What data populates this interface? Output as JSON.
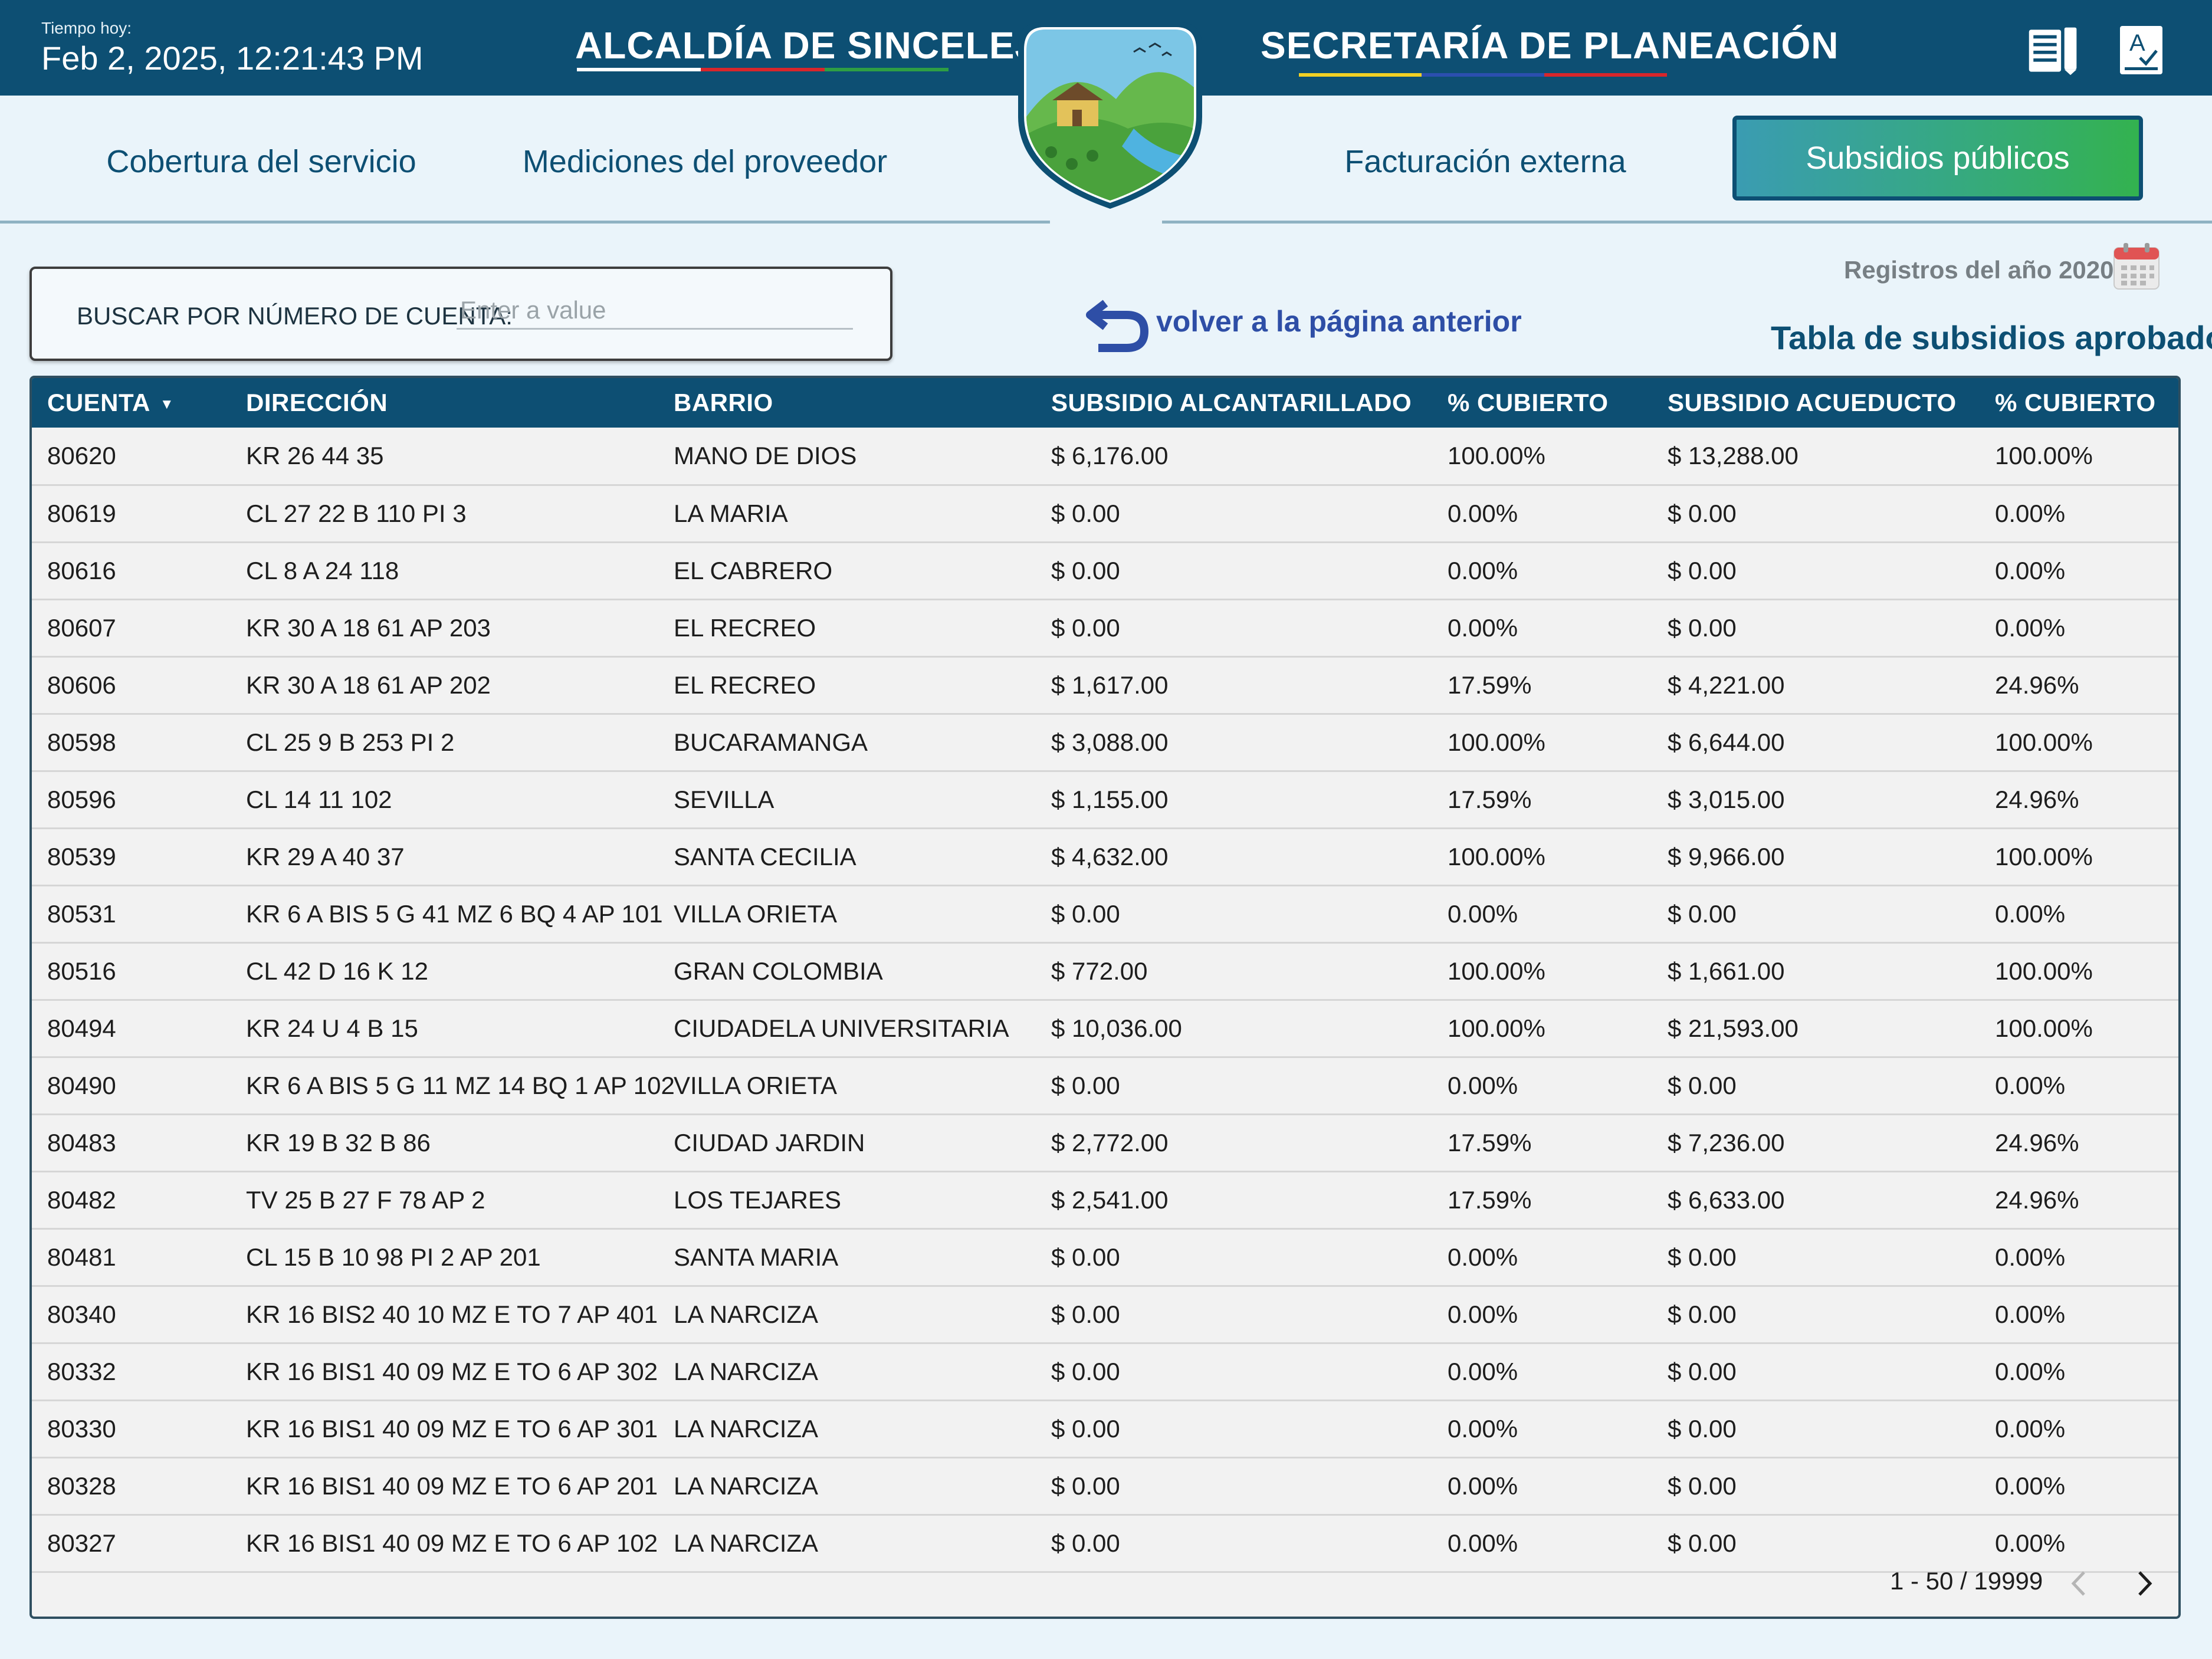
{
  "header": {
    "time_label": "Tiempo hoy:",
    "time_value": "Feb 2, 2025, 12:21:43 PM",
    "title_left": "ALCALDÍA DE SINCELEJO",
    "title_right": "SECRETARÍA DE PLANEACIÓN",
    "icons": [
      "document-icon",
      "spellcheck-icon",
      "shield-logo"
    ]
  },
  "nav": {
    "tabs": [
      {
        "label": "Cobertura del servicio",
        "active": false
      },
      {
        "label": "Mediciones del proveedor",
        "active": false
      },
      {
        "label": "Facturación externa",
        "active": false
      },
      {
        "label": "Subsidios públicos",
        "active": true
      }
    ]
  },
  "search": {
    "label": "BUSCAR POR NÚMERO DE CUENTA:",
    "placeholder": "Enter a value",
    "value": ""
  },
  "back_link": {
    "label": "volver a la página anterior",
    "icon": "undo-arrow-icon"
  },
  "year_label": "Registros del año 2020",
  "table_title": "Tabla de subsidios aprobados",
  "table": {
    "columns": [
      "CUENTA",
      "DIRECCIÓN",
      "BARRIO",
      "SUBSIDIO ALCANTARILLADO",
      "% CUBIERTO",
      "SUBSIDIO ACUEDUCTO",
      "% CUBIERTO"
    ],
    "sort": {
      "column": "CUENTA",
      "direction": "desc"
    },
    "rows": [
      [
        "80620",
        "KR 26 44 35",
        "MANO DE DIOS",
        "$ 6,176.00",
        "100.00%",
        "$ 13,288.00",
        "100.00%"
      ],
      [
        "80619",
        "CL 27 22 B 110 PI 3",
        "LA MARIA",
        "$ 0.00",
        "0.00%",
        "$ 0.00",
        "0.00%"
      ],
      [
        "80616",
        "CL 8 A 24 118",
        "EL CABRERO",
        "$ 0.00",
        "0.00%",
        "$ 0.00",
        "0.00%"
      ],
      [
        "80607",
        "KR 30 A 18 61 AP 203",
        "EL RECREO",
        "$ 0.00",
        "0.00%",
        "$ 0.00",
        "0.00%"
      ],
      [
        "80606",
        "KR 30 A 18 61 AP 202",
        "EL RECREO",
        "$ 1,617.00",
        "17.59%",
        "$ 4,221.00",
        "24.96%"
      ],
      [
        "80598",
        "CL 25 9 B 253 PI 2",
        "BUCARAMANGA",
        "$ 3,088.00",
        "100.00%",
        "$ 6,644.00",
        "100.00%"
      ],
      [
        "80596",
        "CL 14 11 102",
        "SEVILLA",
        "$ 1,155.00",
        "17.59%",
        "$ 3,015.00",
        "24.96%"
      ],
      [
        "80539",
        "KR 29 A 40 37",
        "SANTA CECILIA",
        "$ 4,632.00",
        "100.00%",
        "$ 9,966.00",
        "100.00%"
      ],
      [
        "80531",
        "KR 6 A BIS 5 G 41 MZ 6 BQ 4 AP 101",
        "VILLA ORIETA",
        "$ 0.00",
        "0.00%",
        "$ 0.00",
        "0.00%"
      ],
      [
        "80516",
        "CL 42 D 16 K 12",
        "GRAN COLOMBIA",
        "$ 772.00",
        "100.00%",
        "$ 1,661.00",
        "100.00%"
      ],
      [
        "80494",
        "KR 24 U 4 B 15",
        "CIUDADELA UNIVERSITARIA",
        "$ 10,036.00",
        "100.00%",
        "$ 21,593.00",
        "100.00%"
      ],
      [
        "80490",
        "KR 6 A BIS 5 G 11 MZ 14 BQ 1 AP 102",
        "VILLA ORIETA",
        "$ 0.00",
        "0.00%",
        "$ 0.00",
        "0.00%"
      ],
      [
        "80483",
        "KR 19 B 32 B 86",
        "CIUDAD JARDIN",
        "$ 2,772.00",
        "17.59%",
        "$ 7,236.00",
        "24.96%"
      ],
      [
        "80482",
        "TV 25 B 27 F 78 AP 2",
        "LOS TEJARES",
        "$ 2,541.00",
        "17.59%",
        "$ 6,633.00",
        "24.96%"
      ],
      [
        "80481",
        "CL 15 B 10 98 PI 2 AP 201",
        "SANTA MARIA",
        "$ 0.00",
        "0.00%",
        "$ 0.00",
        "0.00%"
      ],
      [
        "80340",
        "KR 16 BIS2 40 10 MZ E TO 7 AP 401",
        "LA NARCIZA",
        "$ 0.00",
        "0.00%",
        "$ 0.00",
        "0.00%"
      ],
      [
        "80332",
        "KR 16 BIS1 40 09 MZ E TO 6 AP 302",
        "LA NARCIZA",
        "$ 0.00",
        "0.00%",
        "$ 0.00",
        "0.00%"
      ],
      [
        "80330",
        "KR 16 BIS1 40 09 MZ E TO 6 AP 301",
        "LA NARCIZA",
        "$ 0.00",
        "0.00%",
        "$ 0.00",
        "0.00%"
      ],
      [
        "80328",
        "KR 16 BIS1 40 09 MZ E TO 6 AP 201",
        "LA NARCIZA",
        "$ 0.00",
        "0.00%",
        "$ 0.00",
        "0.00%"
      ],
      [
        "80327",
        "KR 16 BIS1 40 09 MZ E TO 6 AP 102",
        "LA NARCIZA",
        "$ 0.00",
        "0.00%",
        "$ 0.00",
        "0.00%"
      ]
    ]
  },
  "pagination": {
    "label": "1 - 50 / 19999"
  },
  "colors": {
    "header_bg": "#0d4f73",
    "page_bg": "#eaf4fa",
    "active_tab_gradient": [
      "#3a9cb2",
      "#33b24f"
    ],
    "flag_yellow": "#f2d024",
    "flag_blue": "#2b4fb0",
    "flag_red": "#d8262b",
    "flag_green": "#2e9e44"
  }
}
